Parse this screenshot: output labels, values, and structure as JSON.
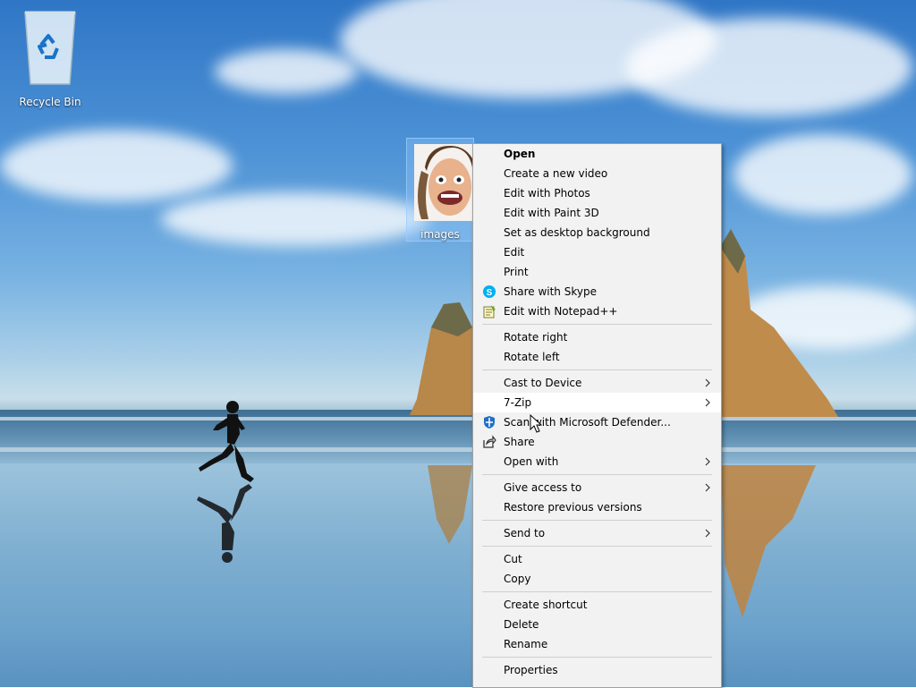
{
  "desktop": {
    "icons": {
      "recycle_bin": "Recycle Bin",
      "image_file": "images"
    }
  },
  "context_menu": {
    "groups": [
      [
        {
          "label": "Open",
          "bold": true
        },
        {
          "label": "Create a new video"
        },
        {
          "label": "Edit with Photos"
        },
        {
          "label": "Edit with Paint 3D"
        },
        {
          "label": "Set as desktop background"
        },
        {
          "label": "Edit"
        },
        {
          "label": "Print"
        },
        {
          "label": "Share with Skype",
          "icon": "skype-icon"
        },
        {
          "label": "Edit with Notepad++",
          "icon": "notepad-plus-plus-icon"
        }
      ],
      [
        {
          "label": "Rotate right"
        },
        {
          "label": "Rotate left"
        }
      ],
      [
        {
          "label": "Cast to Device",
          "submenu": true
        },
        {
          "label": "7-Zip",
          "submenu": true,
          "hovered": true
        },
        {
          "label": "Scan with Microsoft Defender...",
          "icon": "defender-icon"
        },
        {
          "label": "Share",
          "icon": "share-icon"
        },
        {
          "label": "Open with",
          "submenu": true
        }
      ],
      [
        {
          "label": "Give access to",
          "submenu": true
        },
        {
          "label": "Restore previous versions"
        }
      ],
      [
        {
          "label": "Send to",
          "submenu": true
        }
      ],
      [
        {
          "label": "Cut"
        },
        {
          "label": "Copy"
        }
      ],
      [
        {
          "label": "Create shortcut"
        },
        {
          "label": "Delete"
        },
        {
          "label": "Rename"
        }
      ],
      [
        {
          "label": "Properties"
        }
      ]
    ]
  },
  "colors": {
    "menu_bg": "#f2f2f2",
    "menu_hover": "#ffffff",
    "selection_bg": "#99ccff"
  }
}
